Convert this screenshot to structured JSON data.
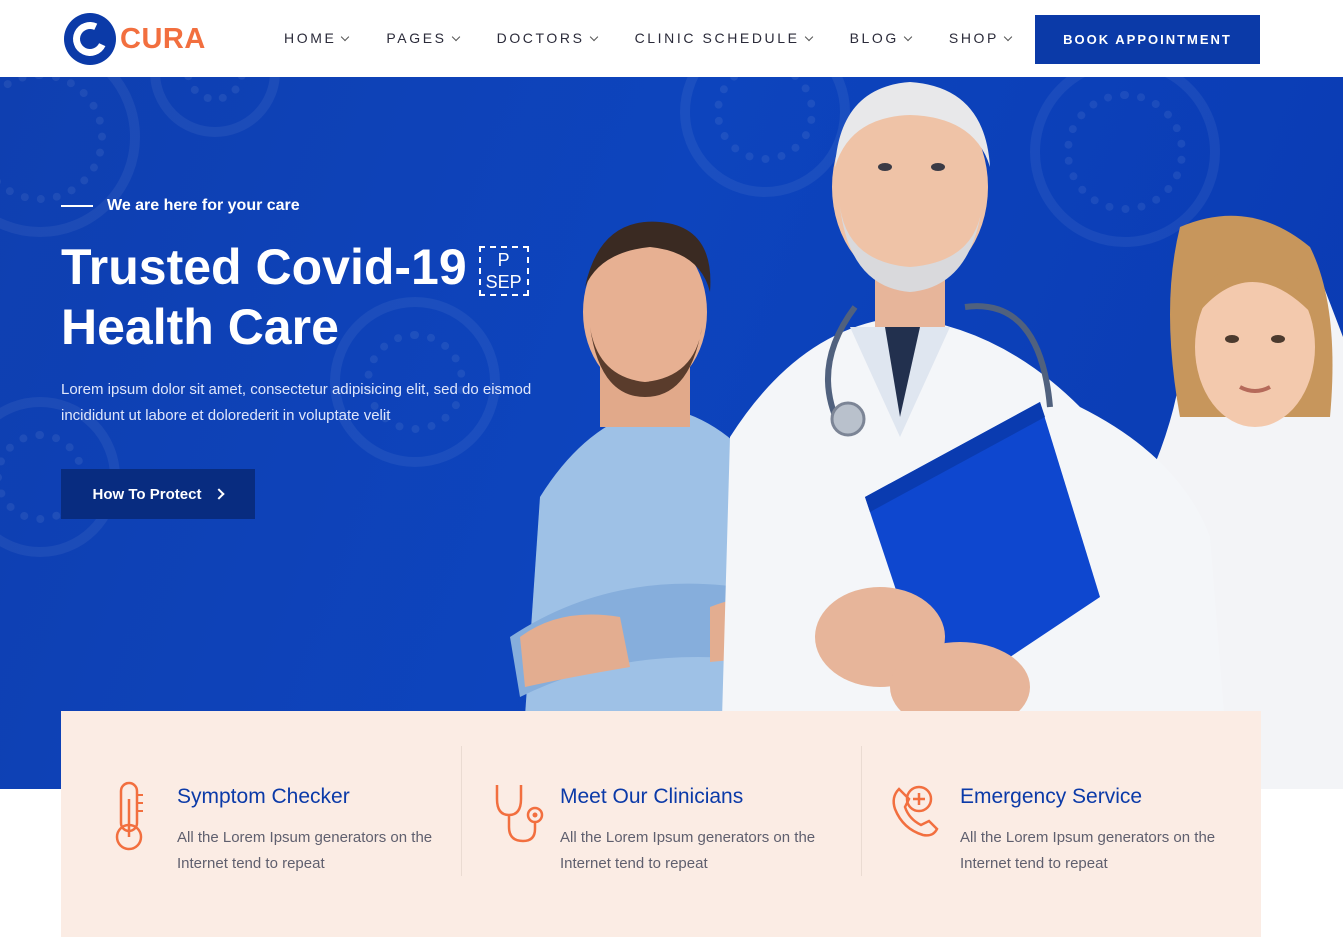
{
  "brand": {
    "logo_text": "CURA",
    "logo_icon": "c-circle-logo-icon",
    "primary_color": "#0b3aa8",
    "accent_color": "#f26f3f"
  },
  "nav": {
    "items": [
      {
        "label": "HOME"
      },
      {
        "label": "PAGES"
      },
      {
        "label": "DOCTORS"
      },
      {
        "label": "CLINIC SCHEDULE"
      },
      {
        "label": "BLOG"
      },
      {
        "label": "SHOP"
      }
    ],
    "cta_label": "BOOK APPOINTMENT"
  },
  "hero": {
    "eyebrow": "We are here for your care",
    "title_line1": "Trusted Covid-19",
    "badge_top": "P",
    "badge_bottom": "SEP",
    "title_line2": "Health Care",
    "description": "Lorem ipsum dolor sit amet, consectetur adipisicing elit, sed do eismod incididunt ut labore et dolorederit in voluptate velit",
    "button_label": "How To Protect"
  },
  "features": [
    {
      "icon": "thermometer-icon",
      "title": "Symptom Checker",
      "desc": "All the Lorem Ipsum generators on the Internet tend to repeat"
    },
    {
      "icon": "stethoscope-icon",
      "title": "Meet Our Clinicians",
      "desc": "All the Lorem Ipsum generators on the Internet tend to repeat"
    },
    {
      "icon": "emergency-phone-icon",
      "title": "Emergency Service",
      "desc": "All the Lorem Ipsum generators on the Internet tend to repeat"
    }
  ]
}
